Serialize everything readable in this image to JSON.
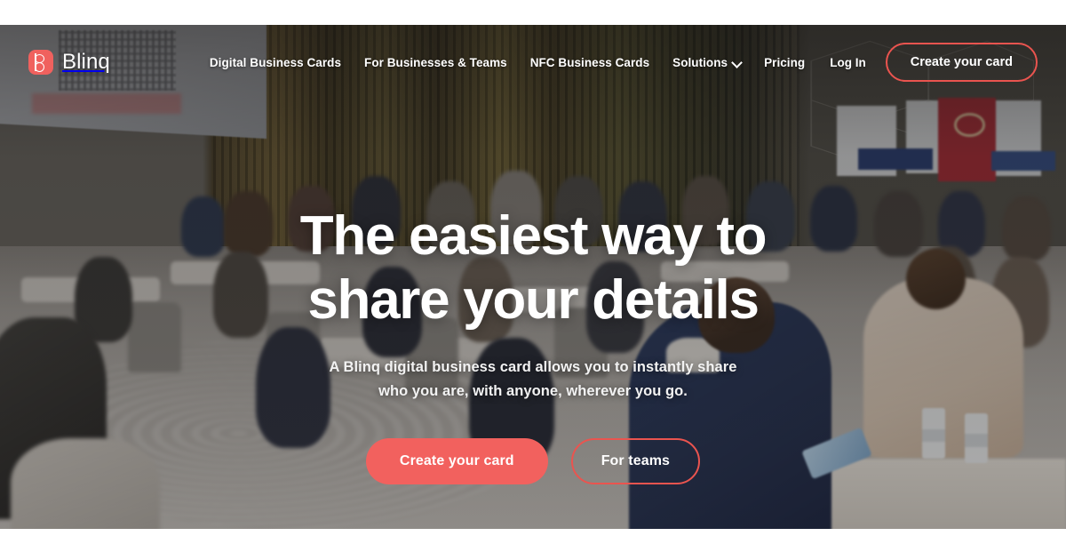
{
  "brand": {
    "name": "Blinq",
    "logo_icon": "blinq-logo-icon",
    "accent_color": "#f2615e"
  },
  "header": {
    "nav": [
      {
        "label": "Digital Business Cards",
        "has_dropdown": false
      },
      {
        "label": "For Businesses & Teams",
        "has_dropdown": false
      },
      {
        "label": "NFC Business Cards",
        "has_dropdown": false
      },
      {
        "label": "Solutions",
        "has_dropdown": true,
        "dropdown_icon": "chevron-down-icon"
      },
      {
        "label": "Pricing",
        "has_dropdown": false
      }
    ],
    "login_label": "Log In",
    "cta_label": "Create your card"
  },
  "hero": {
    "headline_line1": "The easiest way to",
    "headline_line2": "share your details",
    "subhead_line1": "A Blinq digital business card allows you to instantly share",
    "subhead_line2": "who you are, with anyone, wherever you go.",
    "primary_cta": "Create your card",
    "secondary_cta": "For teams",
    "background": "conference-hall-photo"
  },
  "colors": {
    "accent": "#f2615e",
    "accent_border": "#ea544f",
    "text_on_dark": "#ffffff",
    "page_background": "#ffffff"
  }
}
